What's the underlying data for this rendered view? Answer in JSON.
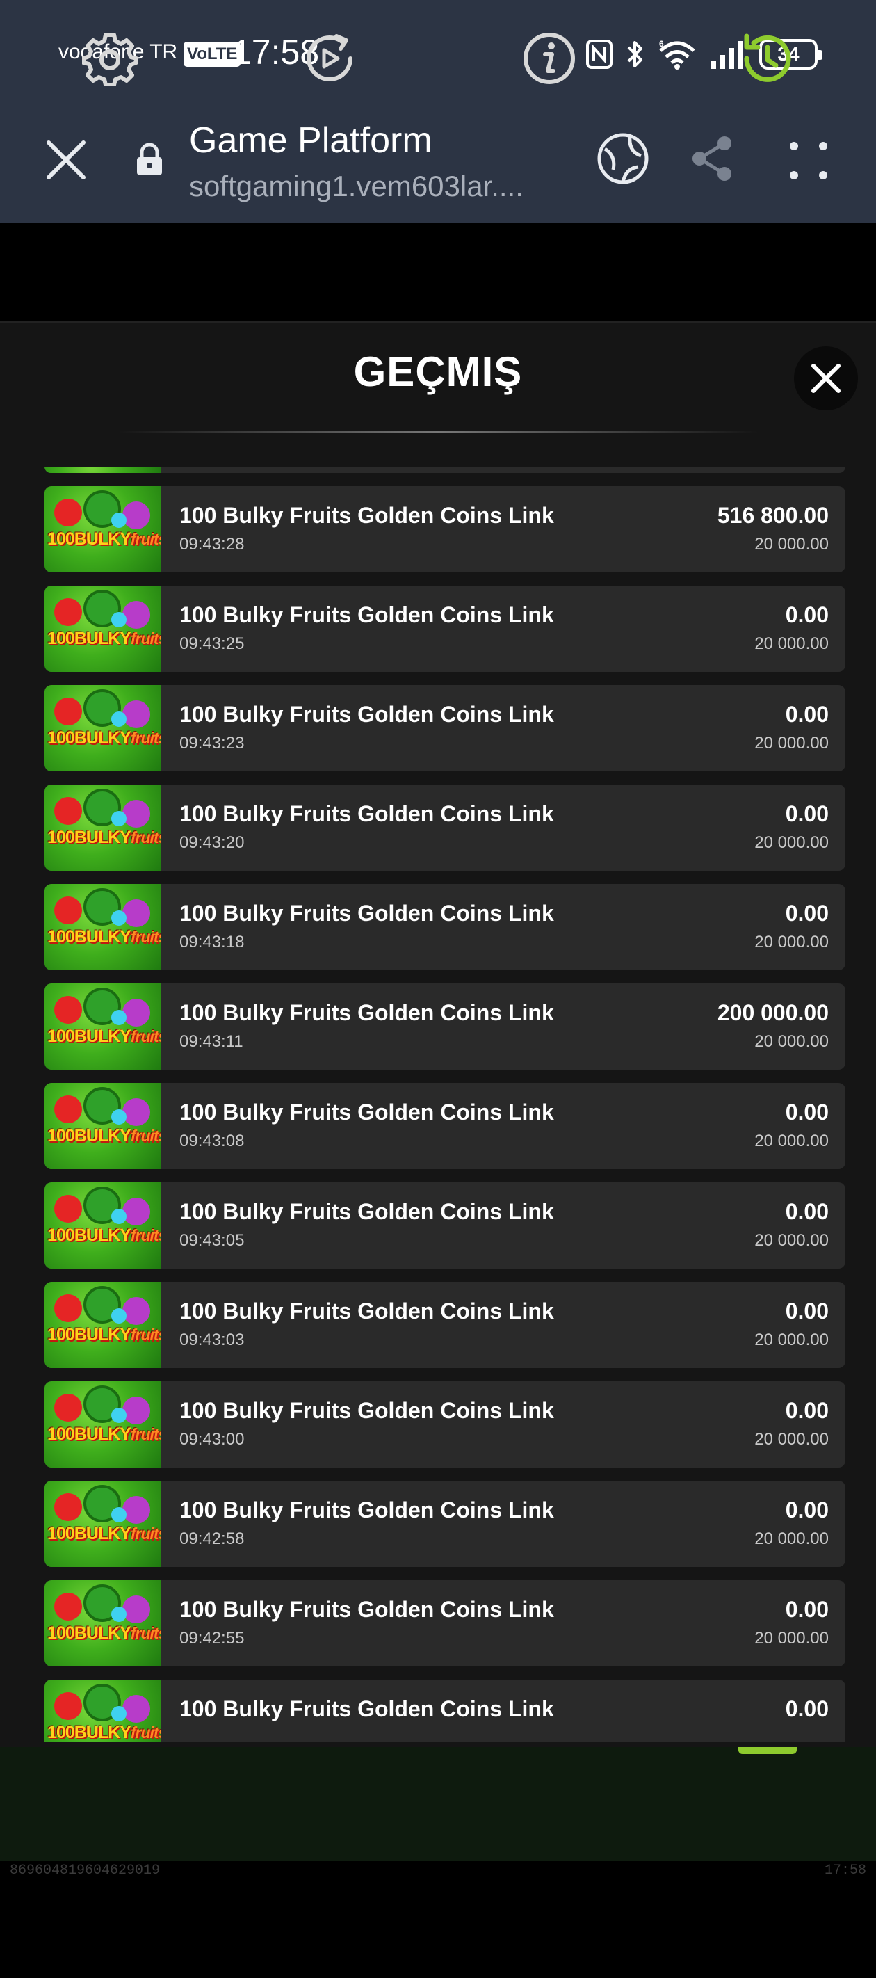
{
  "status_bar": {
    "carrier": "vodafone TR",
    "volte": "VoLTE",
    "time": "17:58",
    "battery": "34",
    "icons": [
      "nfc-icon",
      "bluetooth-icon",
      "wifi-6-icon",
      "signal-icon",
      "battery-icon"
    ]
  },
  "browser": {
    "title": "Game Platform",
    "url": "softgaming1.vem603lar....",
    "icons": [
      "close-icon",
      "lock-icon",
      "globe-icon",
      "share-icon",
      "more-menu-icon"
    ]
  },
  "modal": {
    "title": "GEÇMIŞ",
    "close_icon": "close-icon"
  },
  "history": [
    {
      "name": "100 Bulky Fruits Golden Coins Link",
      "time": "09:43:28",
      "win": "516 800.00",
      "bet": "20 000.00"
    },
    {
      "name": "100 Bulky Fruits Golden Coins Link",
      "time": "09:43:25",
      "win": "0.00",
      "bet": "20 000.00"
    },
    {
      "name": "100 Bulky Fruits Golden Coins Link",
      "time": "09:43:23",
      "win": "0.00",
      "bet": "20 000.00"
    },
    {
      "name": "100 Bulky Fruits Golden Coins Link",
      "time": "09:43:20",
      "win": "0.00",
      "bet": "20 000.00"
    },
    {
      "name": "100 Bulky Fruits Golden Coins Link",
      "time": "09:43:18",
      "win": "0.00",
      "bet": "20 000.00"
    },
    {
      "name": "100 Bulky Fruits Golden Coins Link",
      "time": "09:43:11",
      "win": "200 000.00",
      "bet": "20 000.00"
    },
    {
      "name": "100 Bulky Fruits Golden Coins Link",
      "time": "09:43:08",
      "win": "0.00",
      "bet": "20 000.00"
    },
    {
      "name": "100 Bulky Fruits Golden Coins Link",
      "time": "09:43:05",
      "win": "0.00",
      "bet": "20 000.00"
    },
    {
      "name": "100 Bulky Fruits Golden Coins Link",
      "time": "09:43:03",
      "win": "0.00",
      "bet": "20 000.00"
    },
    {
      "name": "100 Bulky Fruits Golden Coins Link",
      "time": "09:43:00",
      "win": "0.00",
      "bet": "20 000.00"
    },
    {
      "name": "100 Bulky Fruits Golden Coins Link",
      "time": "09:42:58",
      "win": "0.00",
      "bet": "20 000.00"
    },
    {
      "name": "100 Bulky Fruits Golden Coins Link",
      "time": "09:42:55",
      "win": "0.00",
      "bet": "20 000.00"
    },
    {
      "name": "100 Bulky Fruits Golden Coins Link",
      "time": "",
      "win": "0.00",
      "bet": ""
    }
  ],
  "thumbnail_logo": {
    "prefix": "100BULKY",
    "suffix": "fruits"
  },
  "toolbar": {
    "icons": [
      "settings-icon",
      "autoplay-icon",
      "info-icon",
      "history-icon"
    ],
    "active": "history-icon",
    "accent_color": "#8ecb2e"
  },
  "footer": {
    "id": "869604819604629019",
    "time": "17:58"
  }
}
